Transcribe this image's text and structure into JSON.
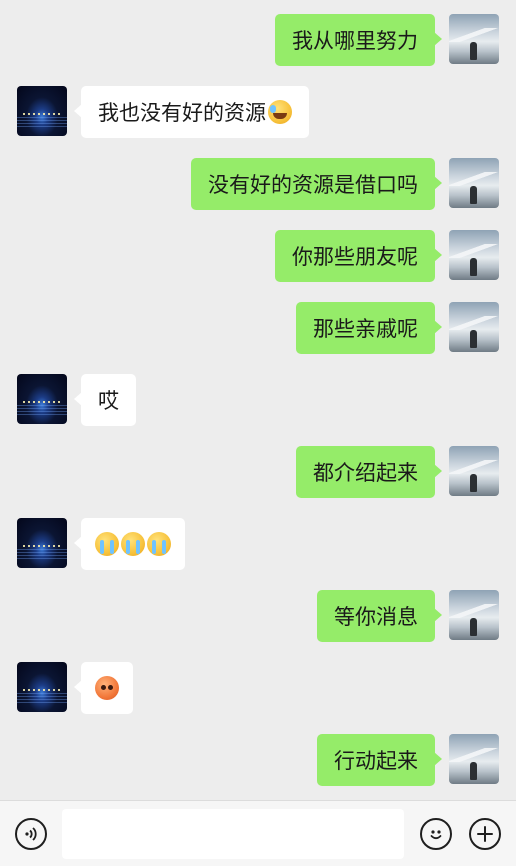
{
  "messages": [
    {
      "side": "me",
      "text": "我从哪里努力"
    },
    {
      "side": "other",
      "text": "我也没有好的资源",
      "emoji": [
        "laugh"
      ]
    },
    {
      "side": "me",
      "text": "没有好的资源是借口吗"
    },
    {
      "side": "me",
      "text": "你那些朋友呢"
    },
    {
      "side": "me",
      "text": "那些亲戚呢"
    },
    {
      "side": "other",
      "text": "哎"
    },
    {
      "side": "me",
      "text": "都介绍起来"
    },
    {
      "side": "other",
      "text": "",
      "emoji": [
        "cry",
        "cry",
        "cry"
      ]
    },
    {
      "side": "me",
      "text": "等你消息"
    },
    {
      "side": "other",
      "text": "",
      "emoji": [
        "angry"
      ]
    },
    {
      "side": "me",
      "text": "行动起来"
    }
  ],
  "input": {
    "value": "",
    "placeholder": ""
  },
  "icons": {
    "voice": "voice-icon",
    "emoji": "emoji-icon",
    "plus": "plus-icon"
  },
  "colors": {
    "my_bubble": "#95ec69",
    "other_bubble": "#ffffff",
    "background": "#ededed"
  }
}
